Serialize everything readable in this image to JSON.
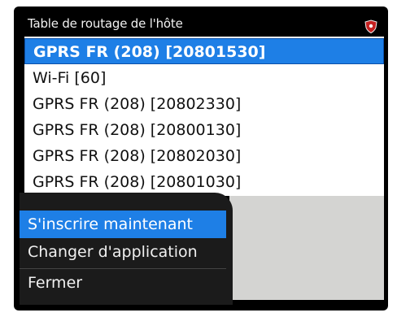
{
  "header": {
    "title": "Table de routage de l'hôte",
    "status_icon": "shield-icon"
  },
  "routing_list": [
    {
      "label": "GPRS FR (208) [20801530]",
      "selected": true
    },
    {
      "label": "Wi-Fi [60]",
      "selected": false
    },
    {
      "label": "GPRS FR (208) [20802330]",
      "selected": false
    },
    {
      "label": "GPRS FR (208) [20800130]",
      "selected": false
    },
    {
      "label": "GPRS FR (208) [20802030]",
      "selected": false
    },
    {
      "label": "GPRS FR (208) [20801030]",
      "selected": false
    }
  ],
  "menu": {
    "items": [
      {
        "label": "S'inscrire maintenant",
        "highlighted": true
      },
      {
        "label": "Changer d'application",
        "highlighted": false
      },
      {
        "label": "Fermer",
        "highlighted": false
      }
    ]
  },
  "colors": {
    "selection": "#1e7fe6",
    "menu_background": "#1b1b1b",
    "frame": "#000000"
  }
}
